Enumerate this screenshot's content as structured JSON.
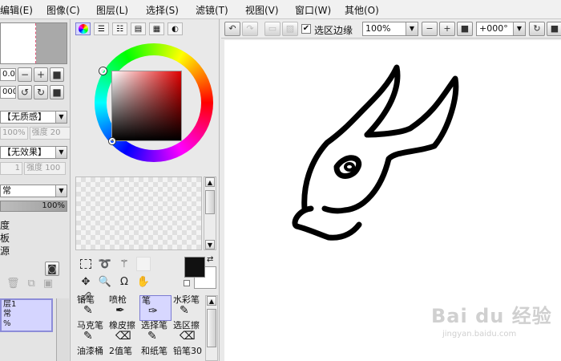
{
  "menu": [
    "编辑(E)",
    "图像(C)",
    "图层(L)",
    "选择(S)",
    "滤镜(T)",
    "视图(V)",
    "窗口(W)",
    "其他(O)"
  ],
  "navigator": {
    "zoom": "0.0%",
    "angle": "000"
  },
  "left_panel": {
    "texture_select": "【无质感】",
    "texture_scale": "100%",
    "texture_strength_label": "强度",
    "texture_strength": "20",
    "effect_select": "【无效果】",
    "effect_width": "1",
    "effect_strength_label": "强度",
    "effect_strength": "100",
    "blend_select": "常",
    "opacity": "100%",
    "options": [
      "度",
      "板",
      "源"
    ],
    "layer": {
      "name": "层1",
      "mode": "常",
      "opacity": "%"
    }
  },
  "color_tabs": [
    "wheel",
    "rgb-sliders",
    "hsv-sliders",
    "swatches",
    "grid",
    "scratch"
  ],
  "colors": {
    "foreground": "#111111",
    "background": "#ffffff",
    "selection": "#d7d7ff"
  },
  "tools": [
    "select-rect",
    "lasso",
    "magic-wand",
    "",
    "move",
    "zoom",
    "rotate",
    "hand",
    "eyedropper"
  ],
  "brushes": [
    {
      "label": "铅笔",
      "selected": false
    },
    {
      "label": "喷枪",
      "selected": false
    },
    {
      "label": "笔",
      "selected": true
    },
    {
      "label": "水彩笔",
      "selected": false
    },
    {
      "label": "马克笔",
      "selected": false
    },
    {
      "label": "橡皮擦",
      "selected": false
    },
    {
      "label": "选择笔",
      "selected": false
    },
    {
      "label": "选区擦",
      "selected": false
    },
    {
      "label": "油漆桶",
      "selected": false
    },
    {
      "label": "2值笔",
      "selected": false
    },
    {
      "label": "和纸笔",
      "selected": false
    },
    {
      "label": "铅笔30",
      "selected": false
    }
  ],
  "toolbar": {
    "selection_edge_label": "选区边缘",
    "selection_edge_checked": true,
    "zoom": "100%",
    "angle": "+000°"
  },
  "watermark": {
    "logo": "Bai du 经验",
    "url": "jingyan.baidu.com"
  }
}
